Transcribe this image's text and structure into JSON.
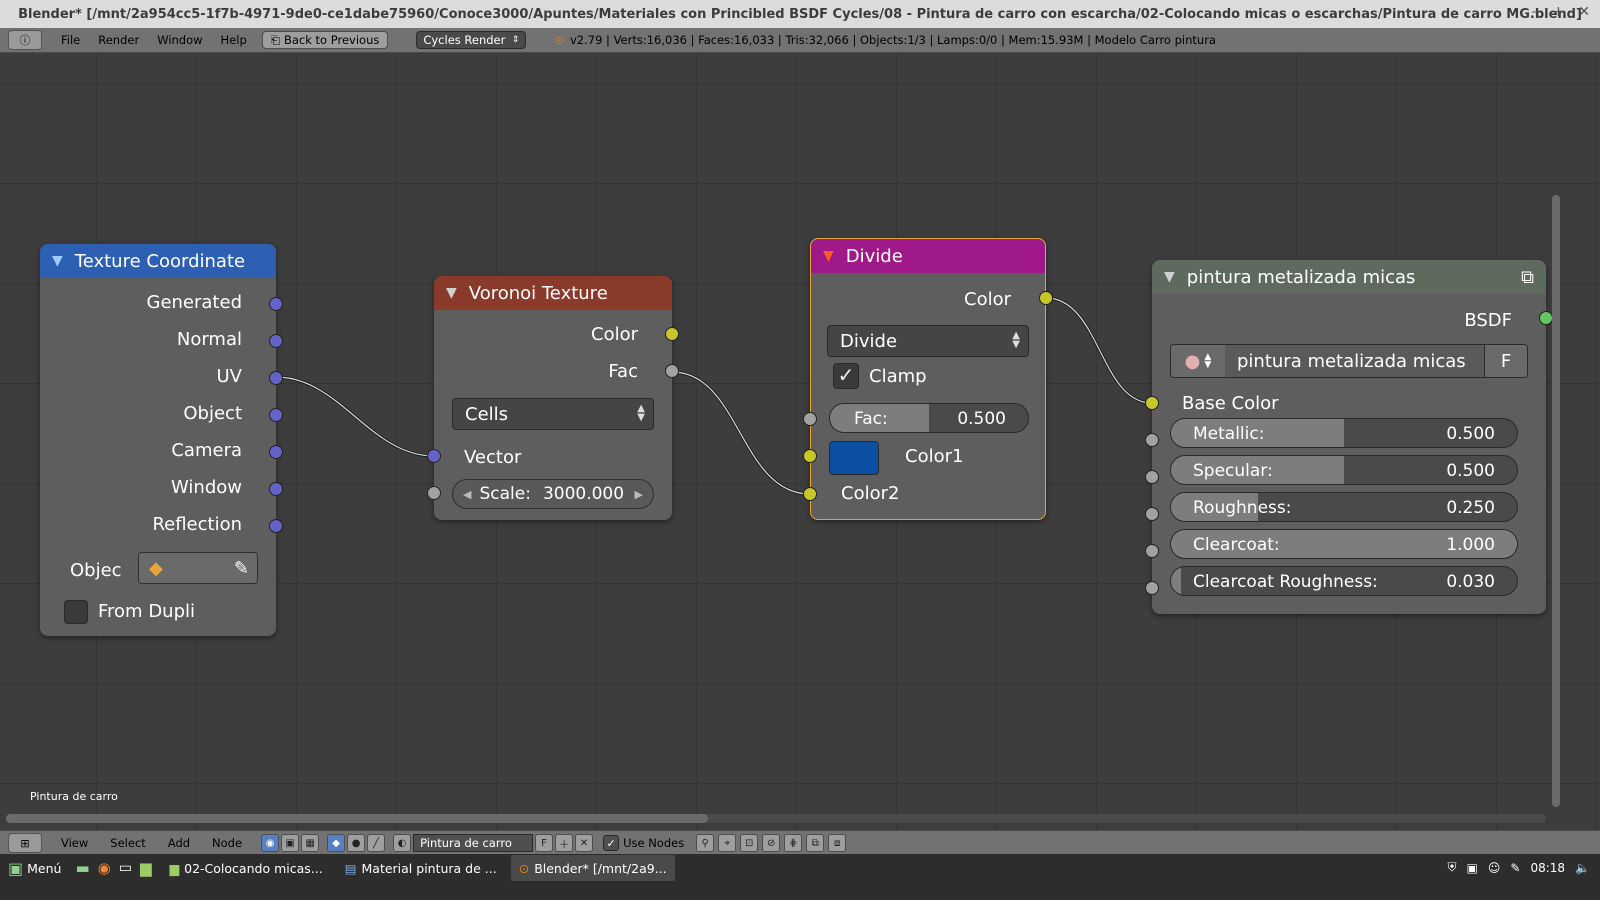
{
  "window": {
    "title": "Blender* [/mnt/2a954cc5-1f7b-4971-9de0-ce1dabe75960/Conoce3000/Apuntes/Materiales con Princibled BSDF Cycles/08 - Pintura de carro con escarcha/02-Colocando micas o escarchas/Pintura de carro MG.blend]",
    "min": "–",
    "max": "+",
    "close": "✕"
  },
  "info_header": {
    "menus": [
      "File",
      "Render",
      "Window",
      "Help"
    ],
    "back_button": "Back to Previous",
    "render_engine": "Cycles Render",
    "stats": "v2.79 | Verts:16,036 | Faces:16,033 | Tris:32,066 | Objects:1/3 | Lamps:0/0 | Mem:15.93M | Modelo Carro pintura"
  },
  "nodes": {
    "texcoord": {
      "title": "Texture Coordinate",
      "outputs": [
        "Generated",
        "Normal",
        "UV",
        "Object",
        "Camera",
        "Window",
        "Reflection"
      ],
      "object_label": "Objec",
      "from_dupli": "From Dupli"
    },
    "voronoi": {
      "title": "Voronoi Texture",
      "outputs": [
        "Color",
        "Fac"
      ],
      "coloring": "Cells",
      "input_vector": "Vector",
      "scale_label": "Scale:",
      "scale_value": "3000.000"
    },
    "divide": {
      "title": "Divide",
      "output": "Color",
      "operation": "Divide",
      "clamp": "Clamp",
      "fac_label": "Fac:",
      "fac_value": "0.500",
      "color1": "Color1",
      "color1_swatch": "#0a4fa3",
      "color2": "Color2"
    },
    "bsdf": {
      "title": "pintura metalizada micas",
      "output": "BSDF",
      "material_name": "pintura metalizada micas",
      "fake_user": "F",
      "base_color": "Base Color",
      "sliders": [
        {
          "label": "Metallic:",
          "value": "0.500",
          "fraction": 0.5
        },
        {
          "label": "Specular:",
          "value": "0.500",
          "fraction": 0.5
        },
        {
          "label": "Roughness:",
          "value": "0.250",
          "fraction": 0.25
        },
        {
          "label": "Clearcoat:",
          "value": "1.000",
          "fraction": 1.0
        },
        {
          "label": "Clearcoat Roughness:",
          "value": "0.030",
          "fraction": 0.03
        }
      ]
    }
  },
  "editor_status": "Pintura de carro",
  "node_header": {
    "menus": [
      "View",
      "Select",
      "Add",
      "Node"
    ],
    "material_field": "Pintura de carro",
    "fake_user": "F",
    "use_nodes": "Use Nodes"
  },
  "taskbar": {
    "menu": "Menú",
    "tasks": [
      "02-Colocando micas...",
      "Material pintura de ...",
      "Blender* [/mnt/2a9..."
    ],
    "clock": "08:18"
  },
  "colors": {
    "texcoord_header": "#2d5fb3",
    "voronoi_header": "#8a3a2a",
    "divide_header": "#a0198a",
    "bsdf_header": "#5e6a5e",
    "selected_outline": "#e8a53a"
  }
}
